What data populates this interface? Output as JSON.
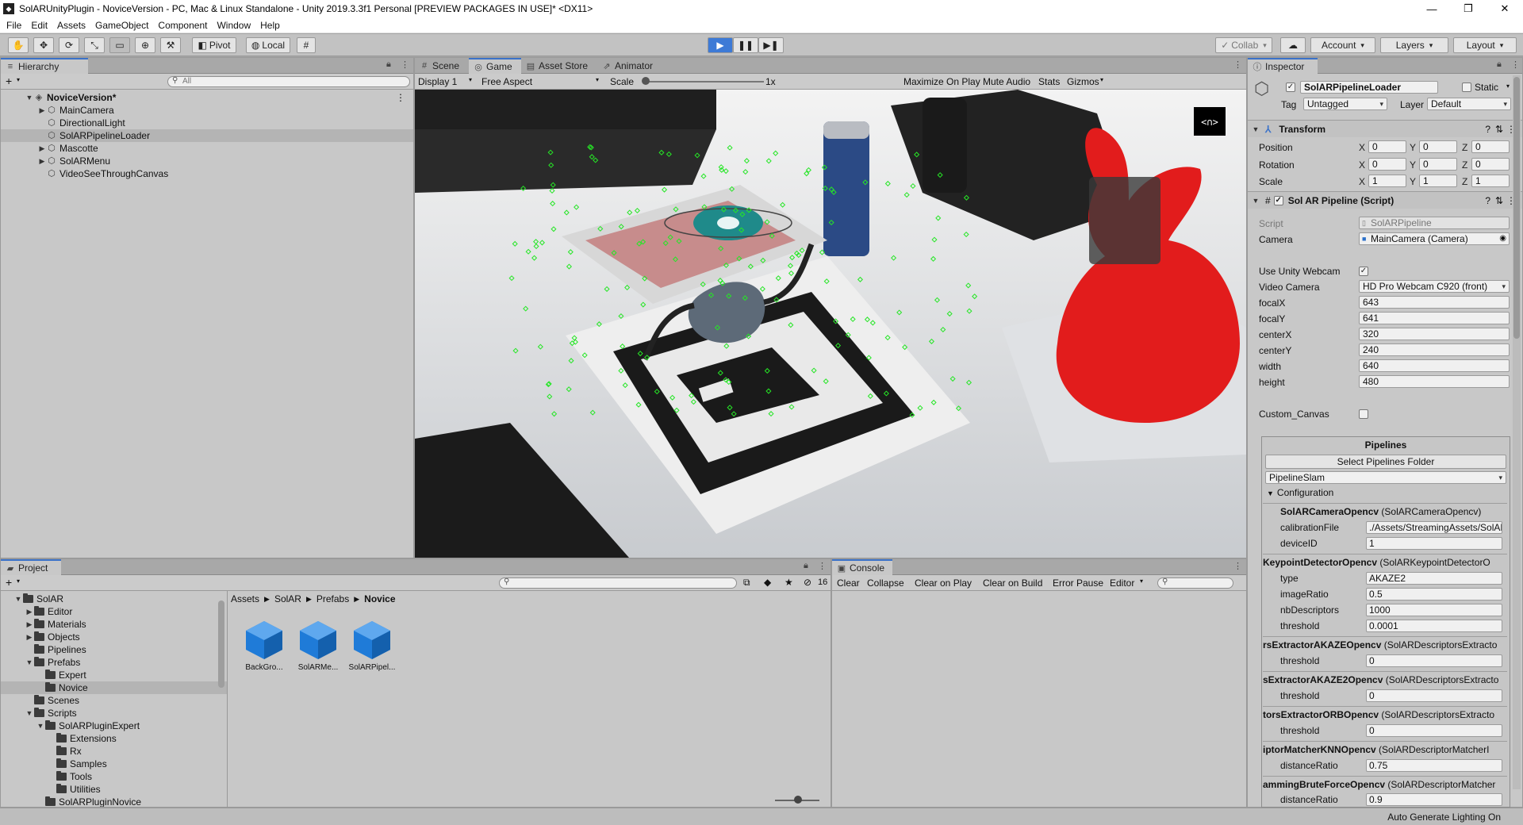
{
  "window": {
    "title": "SolARUnityPlugin - NoviceVersion - PC, Mac & Linux Standalone - Unity 2019.3.3f1 Personal [PREVIEW PACKAGES IN USE]* <DX11>",
    "minimize": "—",
    "maximize": "❐",
    "close": "✕"
  },
  "menu": [
    "File",
    "Edit",
    "Assets",
    "GameObject",
    "Component",
    "Window",
    "Help"
  ],
  "toolbar": {
    "pivot": "Pivot",
    "local": "Local",
    "collab": "Collab",
    "account": "Account",
    "layers": "Layers",
    "layout": "Layout"
  },
  "hierarchy": {
    "tab": "Hierarchy",
    "search_placeholder": "All",
    "add": "+",
    "scene": "NoviceVersion*",
    "items": [
      "MainCamera",
      "DirectionalLight",
      "SolARPipelineLoader",
      "Mascotte",
      "SolARMenu",
      "VideoSeeThroughCanvas"
    ]
  },
  "scene_tabs": {
    "scene": "Scene",
    "game": "Game",
    "asset_store": "Asset Store",
    "animator": "Animator"
  },
  "game_bar": {
    "display": "Display 1",
    "aspect": "Free Aspect",
    "scale_label": "Scale",
    "scale_value": "1x",
    "maximize": "Maximize On Play",
    "mute": "Mute Audio",
    "stats": "Stats",
    "gizmos": "Gizmos",
    "logo": "<∩>"
  },
  "project": {
    "tab": "Project",
    "add": "+",
    "hidden_count": "16",
    "tree": [
      {
        "label": "SolAR",
        "depth": 0,
        "open": true
      },
      {
        "label": "Editor",
        "depth": 1,
        "open": false
      },
      {
        "label": "Materials",
        "depth": 1,
        "open": false
      },
      {
        "label": "Objects",
        "depth": 1,
        "open": false
      },
      {
        "label": "Pipelines",
        "depth": 1,
        "open": null
      },
      {
        "label": "Prefabs",
        "depth": 1,
        "open": true
      },
      {
        "label": "Expert",
        "depth": 2,
        "open": null
      },
      {
        "label": "Novice",
        "depth": 2,
        "open": null
      },
      {
        "label": "Scenes",
        "depth": 1,
        "open": null
      },
      {
        "label": "Scripts",
        "depth": 1,
        "open": true
      },
      {
        "label": "SolARPluginExpert",
        "depth": 2,
        "open": true
      },
      {
        "label": "Extensions",
        "depth": 3,
        "open": null
      },
      {
        "label": "Rx",
        "depth": 3,
        "open": null
      },
      {
        "label": "Samples",
        "depth": 3,
        "open": null
      },
      {
        "label": "Tools",
        "depth": 3,
        "open": null
      },
      {
        "label": "Utilities",
        "depth": 3,
        "open": null
      },
      {
        "label": "SolARPluginNovice",
        "depth": 2,
        "open": null
      }
    ],
    "breadcrumb": [
      "Assets",
      "SolAR",
      "Prefabs",
      "Novice"
    ],
    "assets": [
      "BackGro...",
      "SolARMe...",
      "SolARPipel..."
    ]
  },
  "console": {
    "tab": "Console",
    "clear": "Clear",
    "collapse": "Collapse",
    "clear_on_play": "Clear on Play",
    "clear_on_build": "Clear on Build",
    "error_pause": "Error Pause",
    "editor": "Editor"
  },
  "inspector": {
    "tab": "Inspector",
    "object_name": "SolARPipelineLoader",
    "static": "Static",
    "tag_label": "Tag",
    "tag_value": "Untagged",
    "layer_label": "Layer",
    "layer_value": "Default",
    "transform": {
      "title": "Transform",
      "position": {
        "label": "Position",
        "x": "0",
        "y": "0",
        "z": "0"
      },
      "rotation": {
        "label": "Rotation",
        "x": "0",
        "y": "0",
        "z": "0"
      },
      "scale": {
        "label": "Scale",
        "x": "1",
        "y": "1",
        "z": "1"
      }
    },
    "pipeline_script": {
      "title": "Sol AR Pipeline (Script)",
      "script_label": "Script",
      "script_value": "SolARPipeline",
      "camera_label": "Camera",
      "camera_value": "MainCamera (Camera)",
      "webcam_label": "Use Unity Webcam",
      "video_label": "Video Camera",
      "video_value": "HD Pro Webcam C920 (front)",
      "params": [
        {
          "label": "focalX",
          "value": "643"
        },
        {
          "label": "focalY",
          "value": "641"
        },
        {
          "label": "centerX",
          "value": "320"
        },
        {
          "label": "centerY",
          "value": "240"
        },
        {
          "label": "width",
          "value": "640"
        },
        {
          "label": "height",
          "value": "480"
        }
      ],
      "custom_canvas": "Custom_Canvas"
    },
    "pipelines": {
      "title": "Pipelines",
      "select_folder": "Select Pipelines Folder",
      "selected": "PipelineSlam",
      "configuration": "Configuration",
      "camera": {
        "name": "SolARCameraOpencv",
        "type": "(SolARCameraOpencv)",
        "calib_label": "calibrationFile",
        "calib_value": "./Assets/StreamingAssets/SolAR",
        "device_label": "deviceID",
        "device_value": "1"
      },
      "keypoint": {
        "name": "KeypointDetectorOpencv",
        "type": "(SolARKeypointDetectorO",
        "type_label": "type",
        "type_value": "AKAZE2",
        "ratio_label": "imageRatio",
        "ratio_value": "0.5",
        "nb_label": "nbDescriptors",
        "nb_value": "1000",
        "thr_label": "threshold",
        "thr_value": "0.0001"
      },
      "blocks": [
        {
          "name": "rsExtractorAKAZEOpencv",
          "type": "(SolARDescriptorsExtracto",
          "label": "threshold",
          "value": "0"
        },
        {
          "name": "sExtractorAKAZE2Opencv",
          "type": "(SolARDescriptorsExtracto",
          "label": "threshold",
          "value": "0"
        },
        {
          "name": "torsExtractorORBOpencv",
          "type": "(SolARDescriptorsExtracto",
          "label": "threshold",
          "value": "0"
        },
        {
          "name": "iptorMatcherKNNOpencv",
          "type": "(SolARDescriptorMatcherI",
          "label": "distanceRatio",
          "value": "0.75"
        },
        {
          "name": "ammingBruteForceOpencv",
          "type": "(SolARDescriptorMatcher",
          "label": "distanceRatio",
          "value": "0.9"
        }
      ]
    }
  },
  "status": {
    "text": "Auto Generate Lighting On"
  },
  "colors": {
    "accent": "#3a72c9",
    "play": "#3d7ad6",
    "bunny": "#e21c1c",
    "keypoint": "#26e626",
    "asset_cube": "#1f7bd8"
  }
}
